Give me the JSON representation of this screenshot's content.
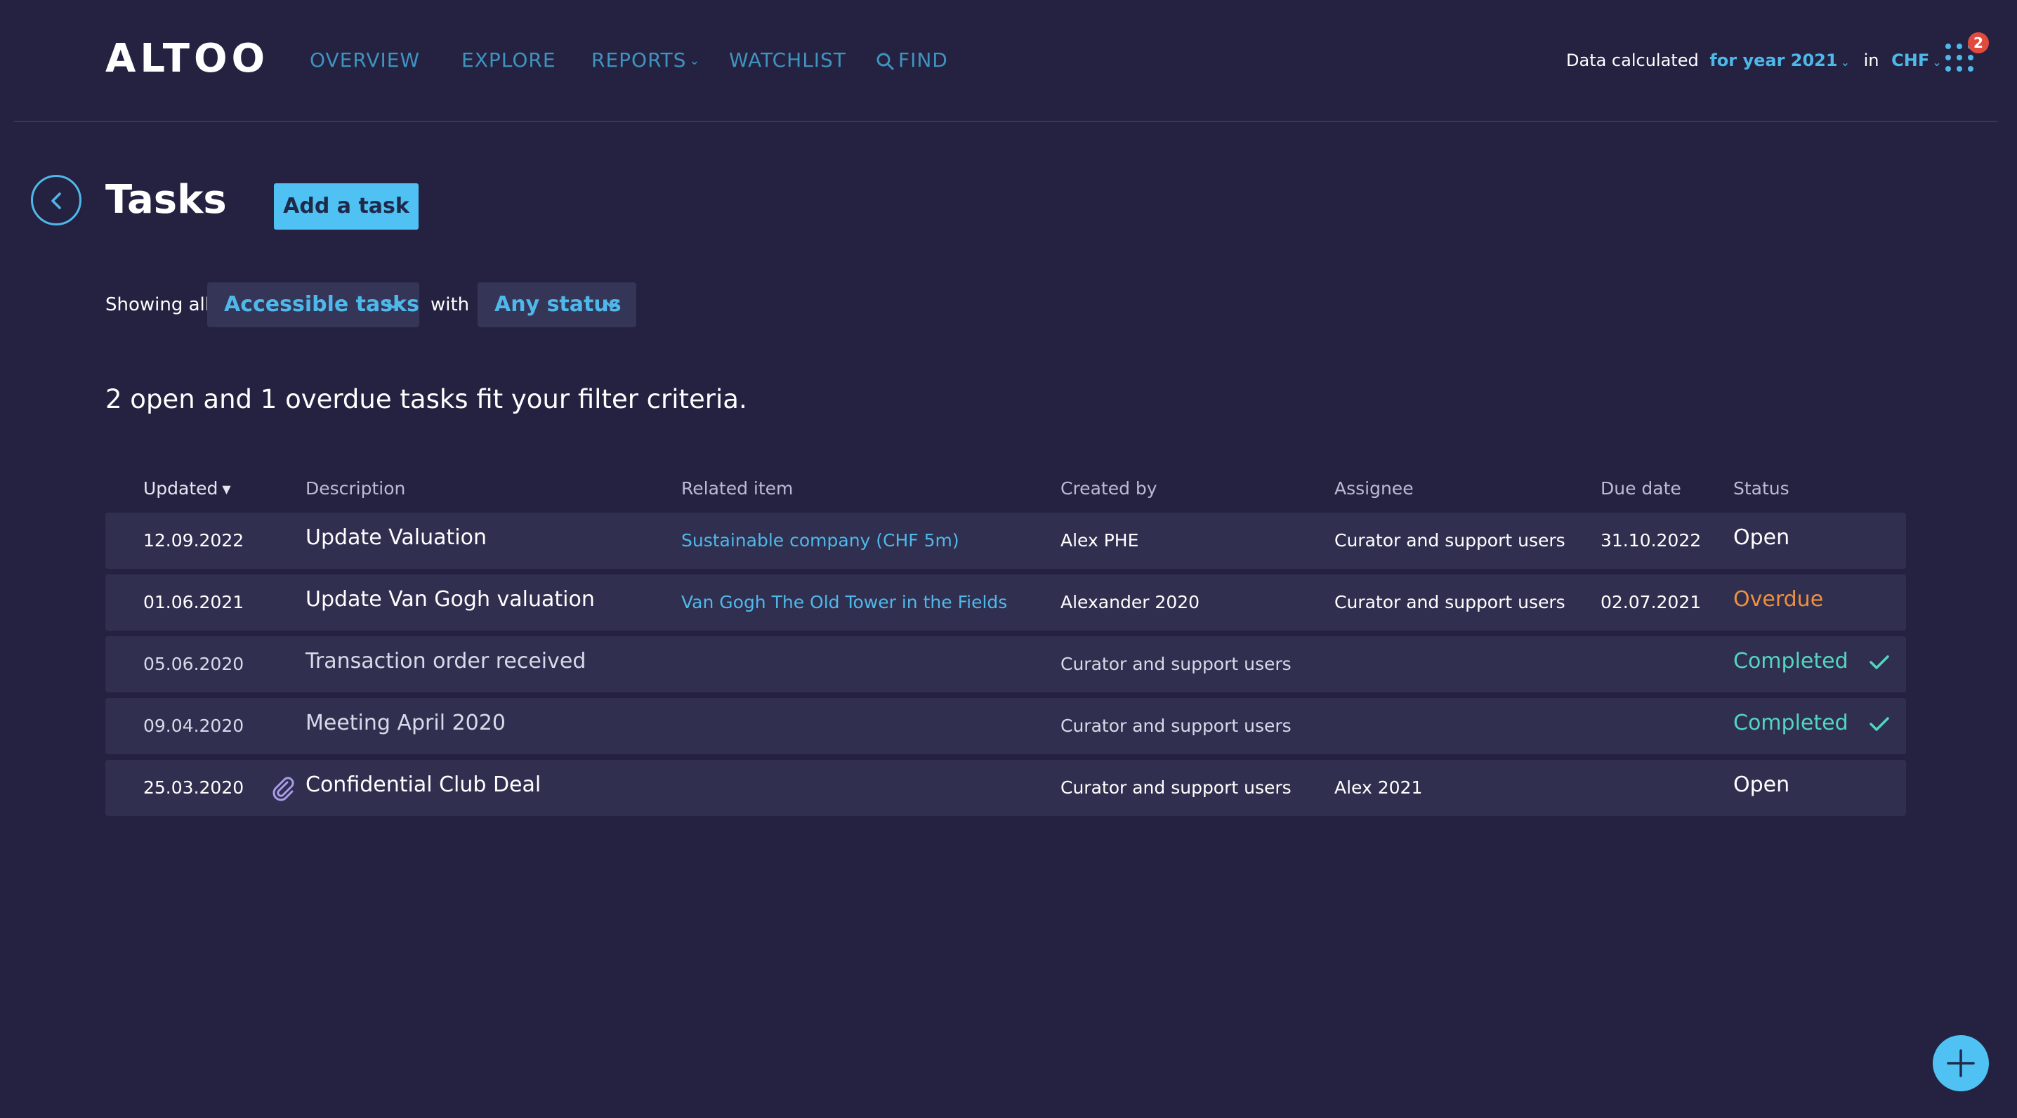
{
  "app": {
    "logo": "ALTOO",
    "nav": {
      "overview": "OVERVIEW",
      "explore": "EXPLORE",
      "reports": "REPORTS",
      "watchlist": "WATCHLIST",
      "find": "FIND"
    },
    "data_calc": {
      "label": "Data calculated",
      "year": "for year 2021",
      "in": "in",
      "currency": "CHF"
    },
    "notifications_count": "2"
  },
  "page": {
    "title": "Tasks",
    "add_button": "Add a task",
    "filters": {
      "showing_all": "Showing all",
      "scope": "Accessible tasks",
      "with": "with",
      "status": "Any status"
    },
    "summary": "2 open and 1 overdue tasks fit your filter criteria."
  },
  "table": {
    "headers": {
      "updated": "Updated",
      "description": "Description",
      "related": "Related item",
      "created_by": "Created by",
      "assignee": "Assignee",
      "due_date": "Due date",
      "status": "Status"
    },
    "rows": [
      {
        "updated": "12.09.2022",
        "description": "Update Valuation",
        "related": "Sustainable company (CHF 5m)",
        "created_by": "Alex PHE",
        "assignee": "Curator and support users",
        "due_date": "31.10.2022",
        "status": "Open"
      },
      {
        "updated": "01.06.2021",
        "description": "Update Van Gogh valuation",
        "related": "Van Gogh The Old Tower in the Fields",
        "created_by": "Alexander 2020",
        "assignee": "Curator and support users",
        "due_date": "02.07.2021",
        "status": "Overdue"
      },
      {
        "updated": "05.06.2020",
        "description": "Transaction order received",
        "related": "",
        "created_by": "Curator and support users",
        "assignee": "",
        "due_date": "",
        "status": "Completed"
      },
      {
        "updated": "09.04.2020",
        "description": "Meeting April 2020",
        "related": "",
        "created_by": "Curator and support users",
        "assignee": "",
        "due_date": "",
        "status": "Completed"
      },
      {
        "updated": "25.03.2020",
        "description": "Confidential Club Deal",
        "related": "",
        "created_by": "Curator and support users",
        "assignee": "Alex 2021",
        "due_date": "",
        "status": "Open",
        "has_attachment": true
      }
    ]
  },
  "icons": {
    "back": "chevron-left-icon",
    "find": "search-icon",
    "apps": "apps-grid-icon",
    "attachment": "paperclip-icon",
    "completed": "checkmark-icon",
    "fab": "plus-icon"
  },
  "colors": {
    "background": "#242240",
    "accent": "#4fc1f2",
    "link": "#4fb8ea",
    "overdue": "#f0903d",
    "completed": "#53d6c0",
    "badge": "#e04b3e"
  }
}
